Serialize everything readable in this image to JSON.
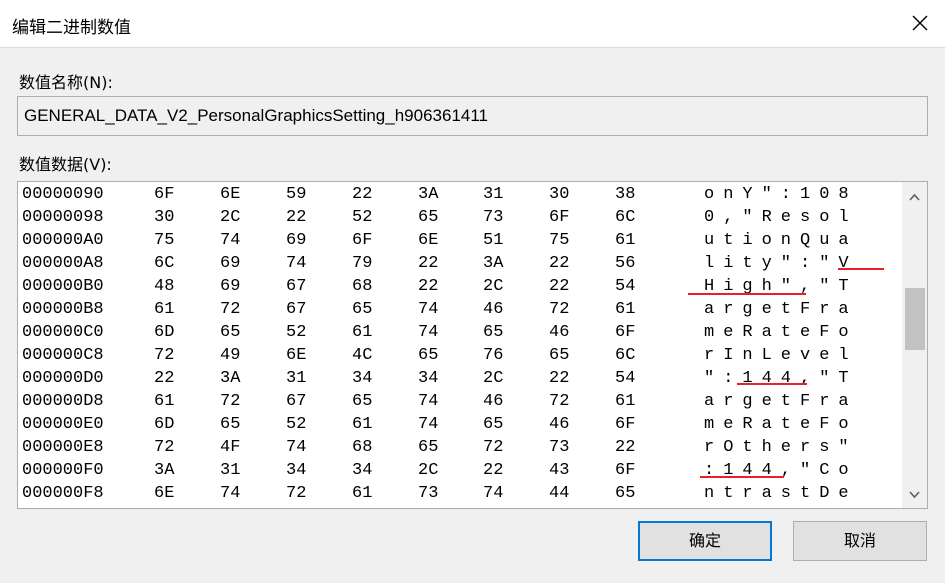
{
  "window": {
    "title": "编辑二进制数值",
    "close_label": "×"
  },
  "value_name": {
    "label": "数值名称(N):",
    "text": "GENERAL_DATA_V2_PersonalGraphicsSetting_h906361411"
  },
  "value_data": {
    "label": "数值数据(V):",
    "rows": [
      {
        "addr": "00000090",
        "bytes": [
          "6F",
          "6E",
          "59",
          "22",
          "3A",
          "31",
          "30",
          "38"
        ],
        "ascii": "onY\":108"
      },
      {
        "addr": "00000098",
        "bytes": [
          "30",
          "2C",
          "22",
          "52",
          "65",
          "73",
          "6F",
          "6C"
        ],
        "ascii": "0,\"Resol"
      },
      {
        "addr": "000000A0",
        "bytes": [
          "75",
          "74",
          "69",
          "6F",
          "6E",
          "51",
          "75",
          "61"
        ],
        "ascii": "utionQua"
      },
      {
        "addr": "000000A8",
        "bytes": [
          "6C",
          "69",
          "74",
          "79",
          "22",
          "3A",
          "22",
          "56"
        ],
        "ascii": "lity\":\"V"
      },
      {
        "addr": "000000B0",
        "bytes": [
          "48",
          "69",
          "67",
          "68",
          "22",
          "2C",
          "22",
          "54"
        ],
        "ascii": "High\",\"T"
      },
      {
        "addr": "000000B8",
        "bytes": [
          "61",
          "72",
          "67",
          "65",
          "74",
          "46",
          "72",
          "61"
        ],
        "ascii": "argetFra"
      },
      {
        "addr": "000000C0",
        "bytes": [
          "6D",
          "65",
          "52",
          "61",
          "74",
          "65",
          "46",
          "6F"
        ],
        "ascii": "meRateFo"
      },
      {
        "addr": "000000C8",
        "bytes": [
          "72",
          "49",
          "6E",
          "4C",
          "65",
          "76",
          "65",
          "6C"
        ],
        "ascii": "rInLevel"
      },
      {
        "addr": "000000D0",
        "bytes": [
          "22",
          "3A",
          "31",
          "34",
          "34",
          "2C",
          "22",
          "54"
        ],
        "ascii": "\":144,\"T"
      },
      {
        "addr": "000000D8",
        "bytes": [
          "61",
          "72",
          "67",
          "65",
          "74",
          "46",
          "72",
          "61"
        ],
        "ascii": "argetFra"
      },
      {
        "addr": "000000E0",
        "bytes": [
          "6D",
          "65",
          "52",
          "61",
          "74",
          "65",
          "46",
          "6F"
        ],
        "ascii": "meRateFo"
      },
      {
        "addr": "000000E8",
        "bytes": [
          "72",
          "4F",
          "74",
          "68",
          "65",
          "72",
          "73",
          "22"
        ],
        "ascii": "rOthers\""
      },
      {
        "addr": "000000F0",
        "bytes": [
          "3A",
          "31",
          "34",
          "34",
          "2C",
          "22",
          "43",
          "6F"
        ],
        "ascii": ":144,\"Co"
      },
      {
        "addr": "000000F8",
        "bytes": [
          "6E",
          "74",
          "72",
          "61",
          "73",
          "74",
          "44",
          "65"
        ],
        "ascii": "ntrastDe"
      }
    ]
  },
  "buttons": {
    "ok": "确定",
    "cancel": "取消"
  },
  "scrollbar": {
    "up_icon": "▲",
    "down_icon": "▼"
  },
  "colors": {
    "highlight_underline": "#e8202a",
    "default_button_border": "#0078d7"
  }
}
